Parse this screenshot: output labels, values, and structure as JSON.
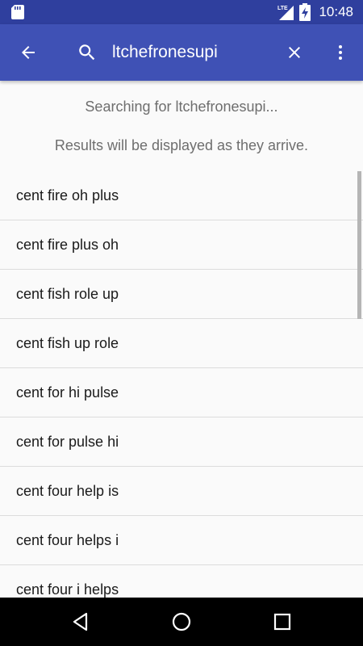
{
  "status_bar": {
    "network": "LTE",
    "time": "10:48"
  },
  "app_bar": {
    "search_query": "ltchefronesupi",
    "icons": {
      "back": "arrow-back-icon",
      "search": "search-icon",
      "clear": "close-icon",
      "overflow": "more-vert-icon"
    }
  },
  "info": {
    "searching": "Searching for ltchefronesupi...",
    "results_note": "Results will be displayed as they arrive."
  },
  "results": [
    "cent fire oh plus",
    "cent fire plus oh",
    "cent fish role up",
    "cent fish up role",
    "cent for hi pulse",
    "cent for pulse hi",
    "cent four help is",
    "cent four helps i",
    "cent four i helps"
  ],
  "colors": {
    "app_bar": "#3f51b5",
    "status_bar": "#2f3f9e",
    "background": "#fafafa",
    "nav_bar": "#000000"
  }
}
